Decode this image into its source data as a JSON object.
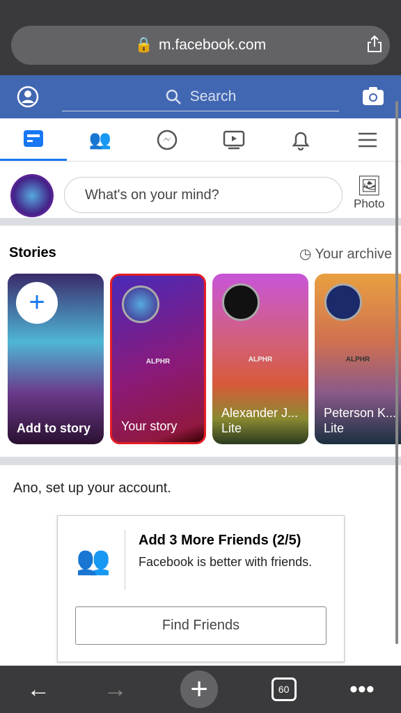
{
  "browser": {
    "url": "m.facebook.com",
    "tab_count": "60"
  },
  "header": {
    "search_placeholder": "Search"
  },
  "composer": {
    "placeholder": "What's on your mind?",
    "photo_label": "Photo"
  },
  "stories": {
    "title": "Stories",
    "archive_label": "Your archive",
    "items": [
      {
        "name": "Add to story"
      },
      {
        "name": "Your story",
        "tag": "ALPHR"
      },
      {
        "name": "Alexander J...",
        "sub": "Lite",
        "tag": "ALPHR"
      },
      {
        "name": "Peterson K...",
        "sub": "Lite",
        "tag": "ALPHR"
      }
    ]
  },
  "setup": {
    "title": "Ano, set up your account.",
    "card_title": "Add 3 More Friends (2/5)",
    "card_text": "Facebook is better with friends.",
    "button": "Find Friends"
  },
  "colors": {
    "brand": "#4267b2",
    "accent": "#1877f2",
    "selected_story": "#e41e26"
  }
}
